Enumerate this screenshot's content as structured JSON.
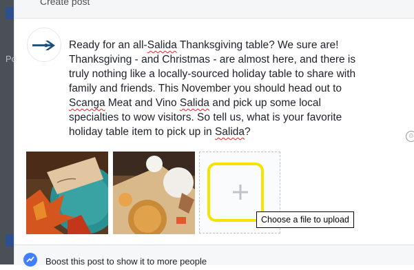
{
  "background": {
    "fragment_text": "Po"
  },
  "composer": {
    "title": "Create post",
    "post_lines": [
      [
        {
          "t": "Ready for an all-"
        },
        {
          "t": "Salida",
          "sp": true
        },
        {
          "t": " Thanksgiving table? We sure are!"
        }
      ],
      [
        {
          "t": "Thanksgiving - and Christmas - are almost here, and there is"
        }
      ],
      [
        {
          "t": "truly nothing like a locally-sourced holiday table to share with"
        }
      ],
      [
        {
          "t": "family and friends. This November you should head out to"
        }
      ],
      [
        {
          "t": "Scanga",
          "sp": true
        },
        {
          "t": " Meat and Vino "
        },
        {
          "t": "Salida",
          "sp": true
        },
        {
          "t": " and pick up some local"
        }
      ],
      [
        {
          "t": "specialties to wow visitors. So tell us, what is your favorite"
        }
      ],
      [
        {
          "t": "holiday table item to pick up in "
        },
        {
          "t": "Salida",
          "sp": true
        },
        {
          "t": "?"
        }
      ]
    ],
    "photos": [
      {
        "icon": "photo-autumn-placecard",
        "alt": "autumn leaves and place card on teal plate"
      },
      {
        "icon": "photo-thanksgiving-pie",
        "alt": "pumpkin pie and autumn table"
      }
    ],
    "upload": {
      "icon": "plus-icon",
      "tooltip": "Choose a file to upload"
    },
    "footer": {
      "boost_text": "Boost this post to show it to more people"
    }
  },
  "colors": {
    "accent": "#4080ff",
    "highlight": "#f7e300",
    "spellcheck": "#e0261d"
  }
}
